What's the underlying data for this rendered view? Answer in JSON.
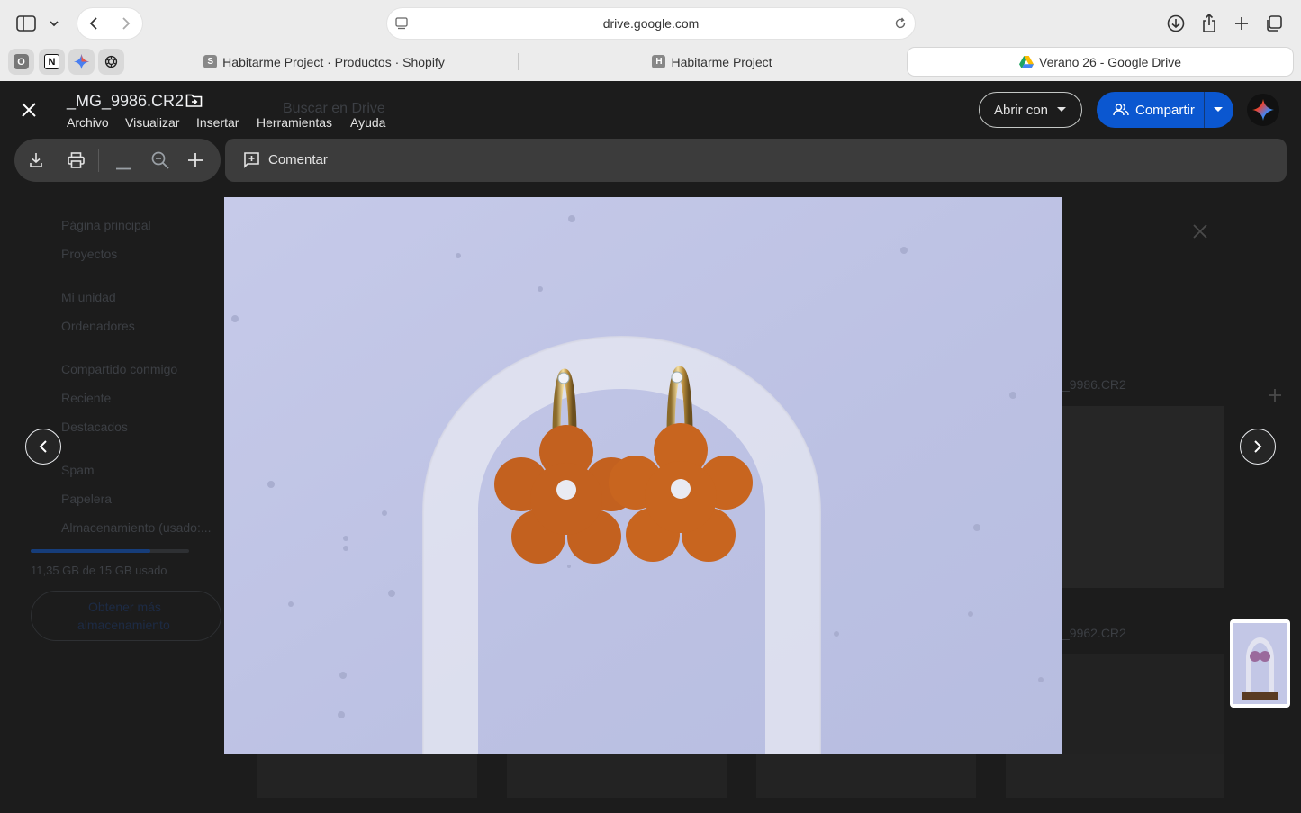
{
  "browser": {
    "address": "drive.google.com",
    "pinned_tabs": [
      {
        "letter": "O",
        "icon": "pinned-o-icon"
      },
      {
        "letter": "N",
        "icon": "notion-icon"
      },
      {
        "letter": "",
        "icon": "gemini-icon"
      },
      {
        "letter": "",
        "icon": "openai-icon"
      }
    ],
    "tabs": [
      {
        "favicon_letter": "S",
        "label": "Habitarme Project · Productos · Shopify"
      },
      {
        "favicon_letter": "H",
        "label": "Habitarme Project"
      },
      {
        "favicon_letter": "",
        "label": "Verano 26 - Google Drive"
      }
    ]
  },
  "viewer": {
    "file_name": "_MG_9986.CR2",
    "menu": [
      "Archivo",
      "Visualizar",
      "Insertar",
      "Herramientas",
      "Ayuda"
    ],
    "open_with_label": "Abrir con",
    "share_label": "Compartir",
    "comment_label": "Comentar",
    "search_placeholder": "Buscar en Drive"
  },
  "drive_background": {
    "sidebar": [
      "Página principal",
      "Proyectos",
      "Mi unidad",
      "Ordenadores",
      "Compartido conmigo",
      "Reciente",
      "Destacados",
      "Spam",
      "Papelera",
      "Almacenamiento (usado:..."
    ],
    "storage_text": "11,35 GB de 15 GB usado",
    "storage_fraction": 0.757,
    "get_storage_label_1": "Obtener más",
    "get_storage_label_2": "almacenamiento",
    "file_1": "_9986.CR2",
    "file_2": "_9962.CR2"
  },
  "colors": {
    "share_blue": "#0b57d0",
    "viewer_bg": "#1c1c1c",
    "toolbar_bg": "#3c3c3c",
    "photo_bg": "#bfc4e6",
    "flower": "#c3611f"
  }
}
